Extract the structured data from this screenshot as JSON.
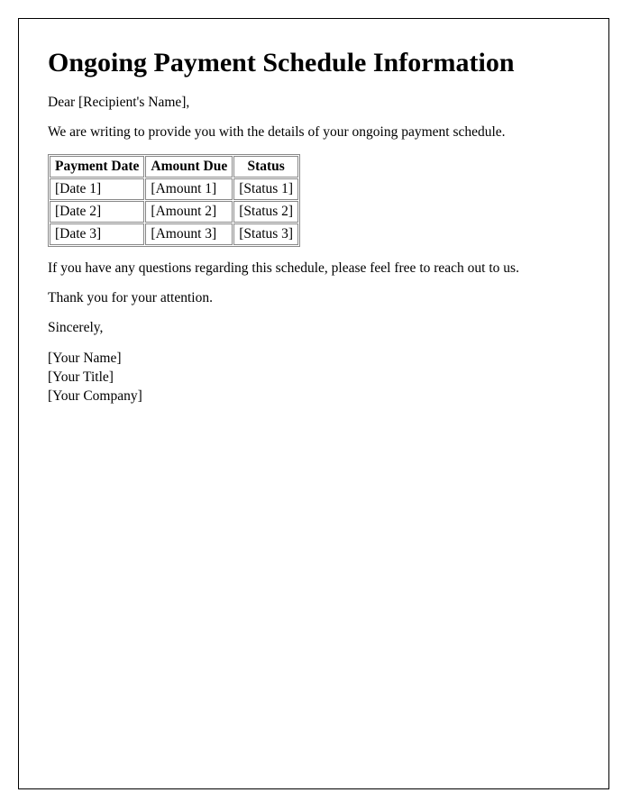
{
  "title": "Ongoing Payment Schedule Information",
  "greeting": "Dear [Recipient's Name],",
  "intro": "We are writing to provide you with the details of your ongoing payment schedule.",
  "table": {
    "headers": {
      "date": "Payment Date",
      "amount": "Amount Due",
      "status": "Status"
    },
    "rows": [
      {
        "date": "[Date 1]",
        "amount": "[Amount 1]",
        "status": "[Status 1]"
      },
      {
        "date": "[Date 2]",
        "amount": "[Amount 2]",
        "status": "[Status 2]"
      },
      {
        "date": "[Date 3]",
        "amount": "[Amount 3]",
        "status": "[Status 3]"
      }
    ]
  },
  "followup": "If you have any questions regarding this schedule, please feel free to reach out to us.",
  "thanks": "Thank you for your attention.",
  "signoff": "Sincerely,",
  "signature": {
    "name": "[Your Name]",
    "title": "[Your Title]",
    "company": "[Your Company]"
  }
}
